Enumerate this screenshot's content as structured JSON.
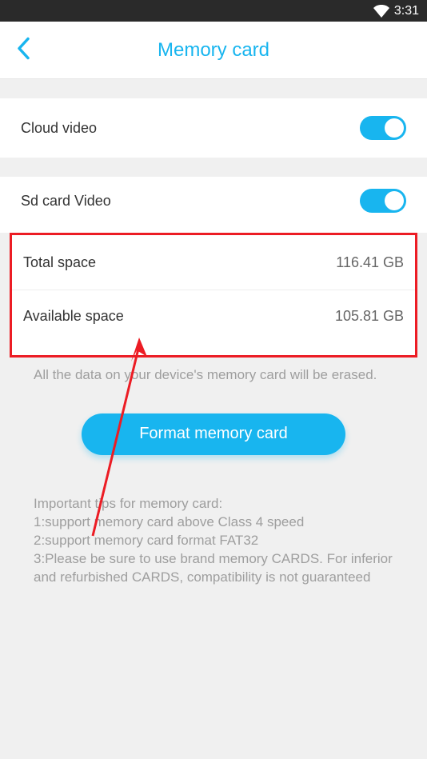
{
  "status": {
    "time": "3:31"
  },
  "header": {
    "title": "Memory card"
  },
  "rows": {
    "cloud_video": {
      "label": "Cloud video",
      "enabled": true
    },
    "sd_card_video": {
      "label": "Sd card Video",
      "enabled": true
    },
    "total_space": {
      "label": "Total space",
      "value": "116.41 GB"
    },
    "available_space": {
      "label": "Available space",
      "value": "105.81 GB"
    }
  },
  "warning_text": "All the data on your device's memory card will be erased.",
  "format_button_label": "Format memory card",
  "tips_text": "Important tips for memory card:\n 1:support memory card above Class 4 speed\n 2:support memory card format FAT32\n 3:Please be sure to use brand memory CARDS. For inferior and refurbished CARDS, compatibility is not guaranteed",
  "annotation": {
    "highlight_color": "#ec1c24"
  }
}
